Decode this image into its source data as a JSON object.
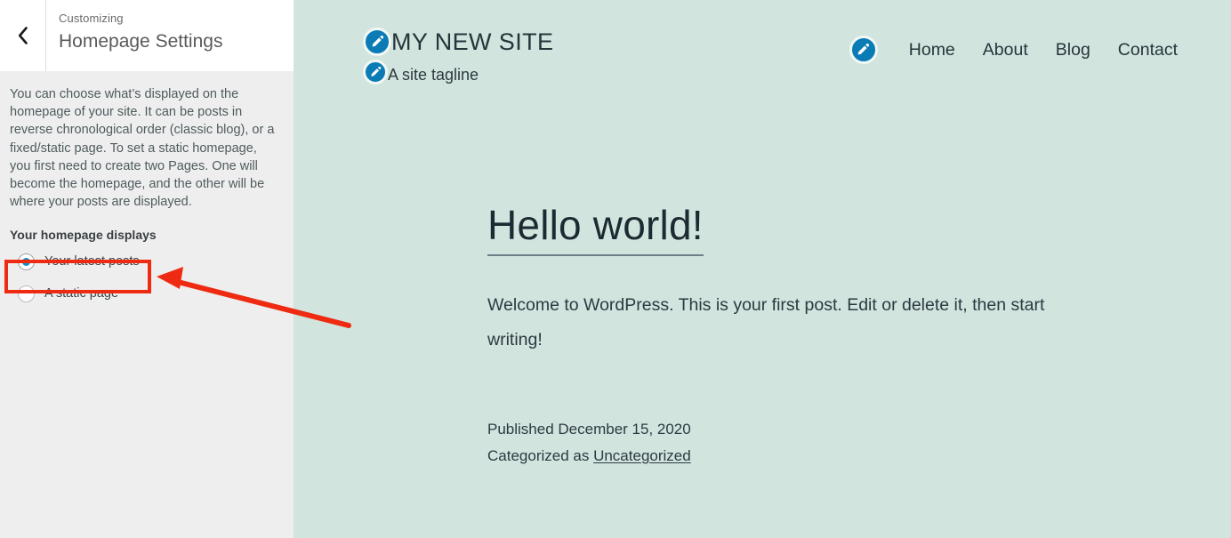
{
  "colors": {
    "sidebar_background": "#eeeeee",
    "panel_header_background": "#ffffff",
    "preview_background": "#d2e4de",
    "annotation_red": "#ee2b12",
    "radio_accent": "#0a8fc2",
    "edit_shortcut_blue": "#0a7bb5"
  },
  "sidebar": {
    "back_button": {
      "icon": "chevron-left-icon",
      "label": "Back"
    },
    "eyebrow": "Customizing",
    "title": "Homepage Settings",
    "description": "You can choose what’s displayed on the homepage of your site. It can be posts in reverse chronological order (classic blog), or a fixed/static page. To set a static homepage, you first need to create two Pages. One will become the homepage, and the other will be where your posts are displayed.",
    "field_label": "Your homepage displays",
    "radio_options": [
      {
        "label": "Your latest posts",
        "selected": true
      },
      {
        "label": "A static page",
        "selected": false
      }
    ]
  },
  "annotation": {
    "highlight_target": "Your latest posts",
    "arrow_from": "390,365",
    "arrow_to": "178,311"
  },
  "preview": {
    "site_title": "MY NEW SITE",
    "site_tagline": "A site tagline",
    "edit_icons": {
      "title": "edit-site-title-icon",
      "tagline": "edit-site-tagline-icon",
      "menu": "edit-menu-icon"
    },
    "nav_links": [
      {
        "label": "Home"
      },
      {
        "label": "About"
      },
      {
        "label": "Blog"
      },
      {
        "label": "Contact"
      }
    ],
    "post": {
      "title": "Hello world!",
      "body": "Welcome to WordPress. This is your first post. Edit or delete it, then start writing!",
      "published_text": "Published December 15, 2020",
      "categorized_prefix": "Categorized as ",
      "category": "Uncategorized"
    }
  }
}
